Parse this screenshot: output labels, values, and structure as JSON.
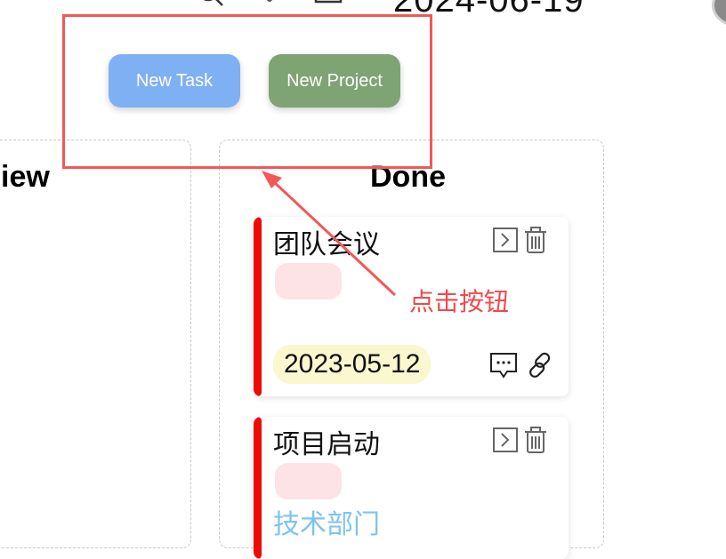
{
  "header": {
    "date": "2024-06-19",
    "icons": [
      "search-icon",
      "bell-icon",
      "calendar-icon"
    ]
  },
  "actions": {
    "new_task_label": "New Task",
    "new_project_label": "New Project",
    "new_task_color": "#7fb0f4",
    "new_project_color": "#7ea474"
  },
  "columns": [
    {
      "title": "iew"
    },
    {
      "title": "Done"
    }
  ],
  "cards": [
    {
      "title": "团队会议",
      "date": "2023-05-12"
    },
    {
      "title": "项目启动",
      "department": "技术部门"
    }
  ],
  "annotation": {
    "text": "点击按钮",
    "color": "#f2585a"
  }
}
